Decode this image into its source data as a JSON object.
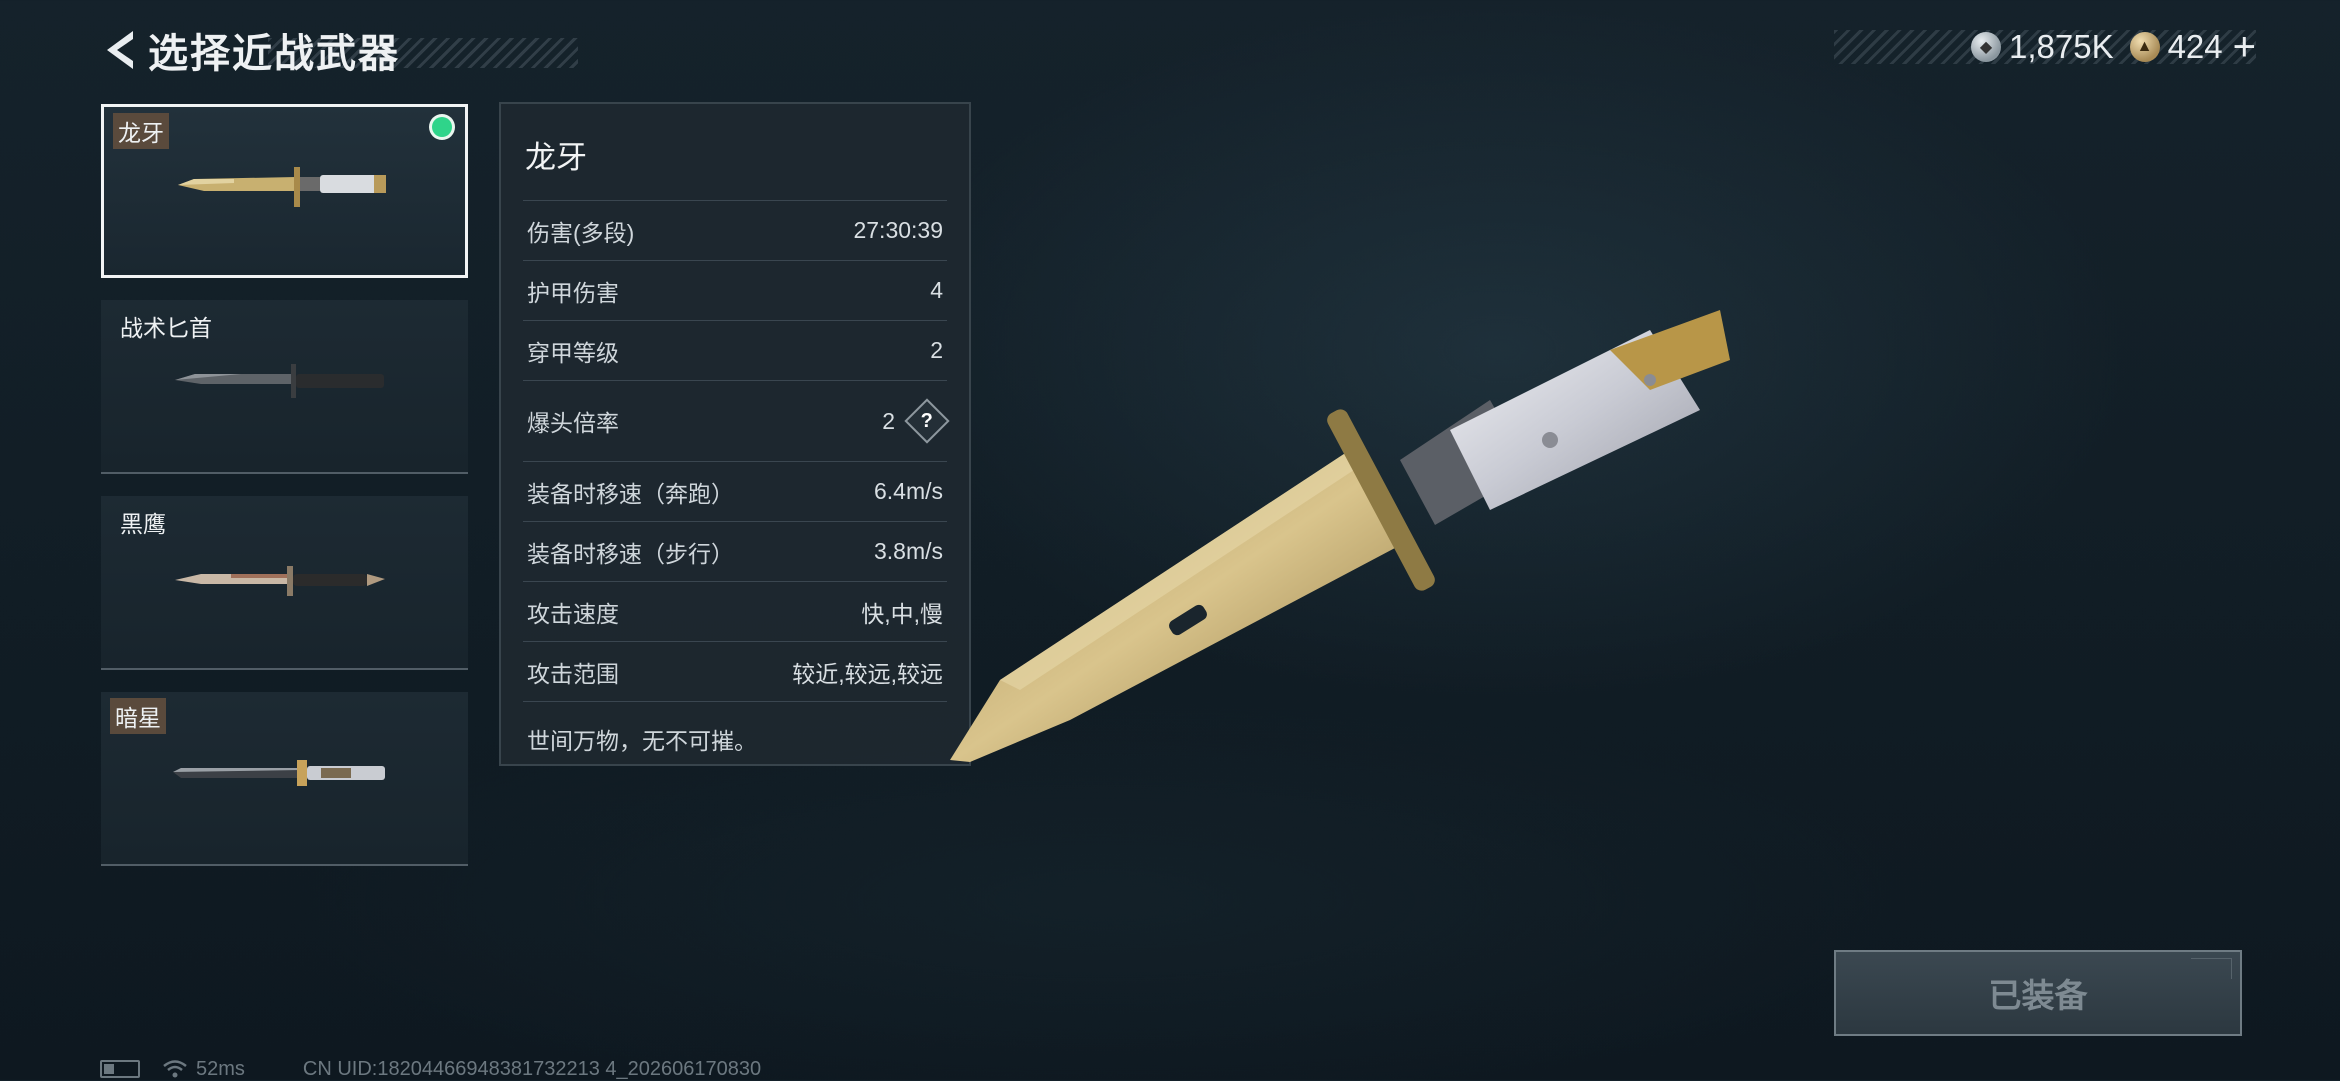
{
  "header": {
    "title": "选择近战武器",
    "back_icon": "chevron-left-icon"
  },
  "currency": {
    "silver": {
      "icon": "silver-coin-icon",
      "amount": "1,875K"
    },
    "gold": {
      "icon": "gold-coin-icon",
      "amount": "424",
      "add_label": "+"
    }
  },
  "weapons": [
    {
      "name": "龙牙",
      "selected": true,
      "equipped": true
    },
    {
      "name": "战术匕首",
      "selected": false,
      "equipped": false
    },
    {
      "name": "黑鹰",
      "selected": false,
      "equipped": false
    },
    {
      "name": "暗星",
      "selected": false,
      "equipped": false
    }
  ],
  "stats": {
    "title": "龙牙",
    "rows": [
      {
        "label": "伤害(多段)",
        "value": "27:30:39"
      },
      {
        "label": "护甲伤害",
        "value": "4"
      },
      {
        "label": "穿甲等级",
        "value": "2"
      },
      {
        "label": "爆头倍率",
        "value": "2",
        "help": "?"
      },
      {
        "label": "装备时移速（奔跑）",
        "value": "6.4m/s"
      },
      {
        "label": "装备时移速（步行）",
        "value": "3.8m/s"
      },
      {
        "label": "攻击速度",
        "value": "快,中,慢"
      },
      {
        "label": "攻击范围",
        "value": "较近,较远,较远"
      }
    ],
    "description": "世间万物，无不可摧。"
  },
  "equip_button": {
    "label": "已装备"
  },
  "footer": {
    "ping": "52ms",
    "uid": "CN UID:18204466948381732213 4_202606170830"
  },
  "colors": {
    "accent_green": "#2fd48a",
    "background": "#15222b",
    "panel": "#1e2830"
  }
}
